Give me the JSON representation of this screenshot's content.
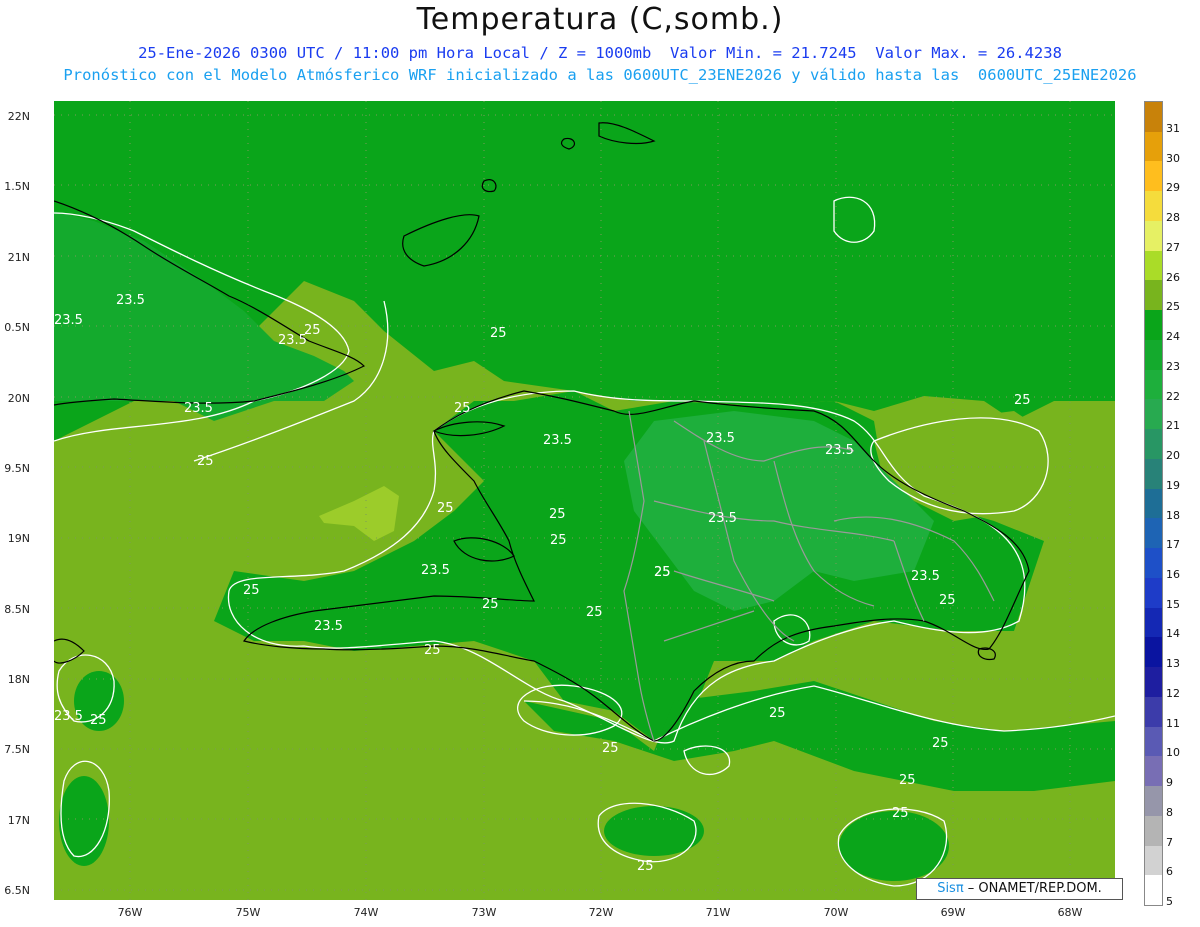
{
  "title": "Temperatura (C,somb.)",
  "subtitle_line1": "25-Ene-2026 0300 UTC / 11:00 pm Hora Local / Z = 1000mb  Valor Min. = 21.7245  Valor Max. = 26.4238",
  "subtitle_line2": "Pronóstico con el Modelo Atmósferico WRF inicializado a las 0600UTC_23ENE2026 y válido hasta las  0600UTC_25ENE2026",
  "y_axis_labels": [
    "22N",
    "1.5N",
    "21N",
    "0.5N",
    "20N",
    "9.5N",
    "19N",
    "8.5N",
    "18N",
    "7.5N",
    "17N",
    "6.5N"
  ],
  "x_axis_labels": [
    "76W",
    "75W",
    "74W",
    "73W",
    "72W",
    "71W",
    "70W",
    "69W",
    "68W"
  ],
  "colorbar": {
    "labels": [
      "31",
      "30",
      "29",
      "28",
      "27",
      "26",
      "25",
      "24",
      "23",
      "22",
      "21",
      "20",
      "19",
      "18",
      "17",
      "16",
      "15",
      "14",
      "13",
      "12",
      "11",
      "10",
      "9",
      "8",
      "7",
      "6",
      "5"
    ],
    "colors": [
      "#c8820a",
      "#e6a00a",
      "#ffbe1e",
      "#f5dc3c",
      "#e6f064",
      "#aadc28",
      "#78b41e",
      "#0aa51a",
      "#14aa2d",
      "#1eaf3c",
      "#28aa50",
      "#289664",
      "#288278",
      "#1e6e96",
      "#1e64b4",
      "#1e50c8",
      "#1e3cc8",
      "#1428b4",
      "#0a14a0",
      "#1e1ea0",
      "#3c3caa",
      "#5a5ab4",
      "#786eb4",
      "#9696aa",
      "#b4b4b4",
      "#d2d2d2",
      "#ffffff"
    ]
  },
  "contour_labels": [
    "23.5",
    "23.5",
    "23.5",
    "25",
    "25",
    "23.5",
    "25",
    "23.5",
    "23.5",
    "23.5",
    "23.5",
    "25",
    "25",
    "25",
    "23.5",
    "25",
    "23.5",
    "25",
    "23.5",
    "25",
    "25",
    "25",
    "25",
    "25",
    "25",
    "25",
    "25",
    "25",
    "25",
    "25",
    "25",
    "23.5",
    "25",
    "25"
  ],
  "credit": {
    "logo": "Sisπ",
    "text": " – ONAMET/REP.DOM."
  }
}
